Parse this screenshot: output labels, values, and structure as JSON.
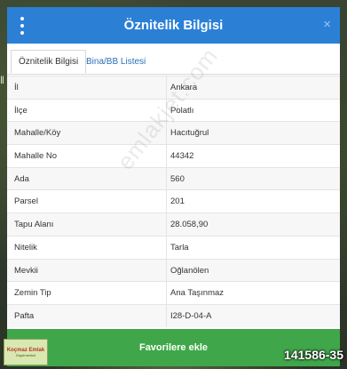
{
  "modal": {
    "title": "Öznitelik Bilgisi",
    "close_label": "×",
    "tabs": [
      {
        "label": "Öznitelik Bilgisi",
        "active": true
      },
      {
        "label": "Bina/BB Listesi",
        "active": false
      }
    ],
    "rows": [
      {
        "key": "İl",
        "value": "Ankara"
      },
      {
        "key": "İlçe",
        "value": "Polatlı"
      },
      {
        "key": "Mahalle/Köy",
        "value": "Hacıtuğrul"
      },
      {
        "key": "Mahalle No",
        "value": "44342"
      },
      {
        "key": "Ada",
        "value": "560"
      },
      {
        "key": "Parsel",
        "value": "201"
      },
      {
        "key": "Tapu Alanı",
        "value": "28.058,90"
      },
      {
        "key": "Nitelik",
        "value": "Tarla"
      },
      {
        "key": "Mevkii",
        "value": "Oğlanölen"
      },
      {
        "key": "Zemin Tip",
        "value": "Ana Taşınmaz"
      },
      {
        "key": "Pafta",
        "value": "I28-D-04-A"
      }
    ],
    "favorite_button": "Favorilere ekle"
  },
  "watermark": "emlakjet.com",
  "listing_id": "141586-35",
  "logo": {
    "line1": "Koçmaz Emlak",
    "line2": "Gayrimenkul"
  },
  "colors": {
    "header": "#2b80d6",
    "favorite": "#3fa74a",
    "tab_link": "#2b6fb5"
  }
}
